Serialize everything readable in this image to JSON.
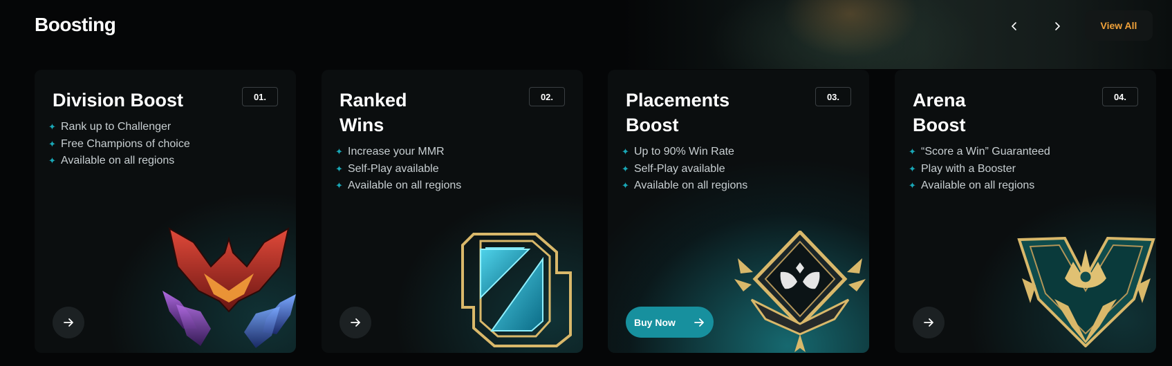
{
  "section": {
    "title": "Boosting",
    "view_all_label": "View All",
    "prev_icon": "chevron-left-icon",
    "next_icon": "chevron-right-icon"
  },
  "cards": [
    {
      "title": "Division Boost",
      "number": "01.",
      "features": [
        "Rank up to Challenger",
        "Free Champions of choice",
        "Available on all regions"
      ],
      "art": "challenger-emblem-art"
    },
    {
      "title": "Ranked Wins",
      "number": "02.",
      "features": [
        "Increase your MMR",
        "Self-Play available",
        "Available on all regions"
      ],
      "art": "ranked-frame-art"
    },
    {
      "title": "Placements Boost",
      "number": "03.",
      "features": [
        "Up to 90% Win Rate",
        "Self-Play available",
        "Available on all regions"
      ],
      "buy_label": "Buy Now",
      "art": "placement-emblem-art"
    },
    {
      "title": "Arena Boost",
      "number": "04.",
      "features": [
        "“Score a Win” Guaranteed",
        "Play with a Booster",
        "Available on all regions"
      ],
      "art": "arena-crest-art"
    }
  ],
  "colors": {
    "accent_teal": "#17909e",
    "star_teal": "#19a7b6",
    "view_all_orange": "#f0a23a",
    "gold": "#d9b86a"
  }
}
